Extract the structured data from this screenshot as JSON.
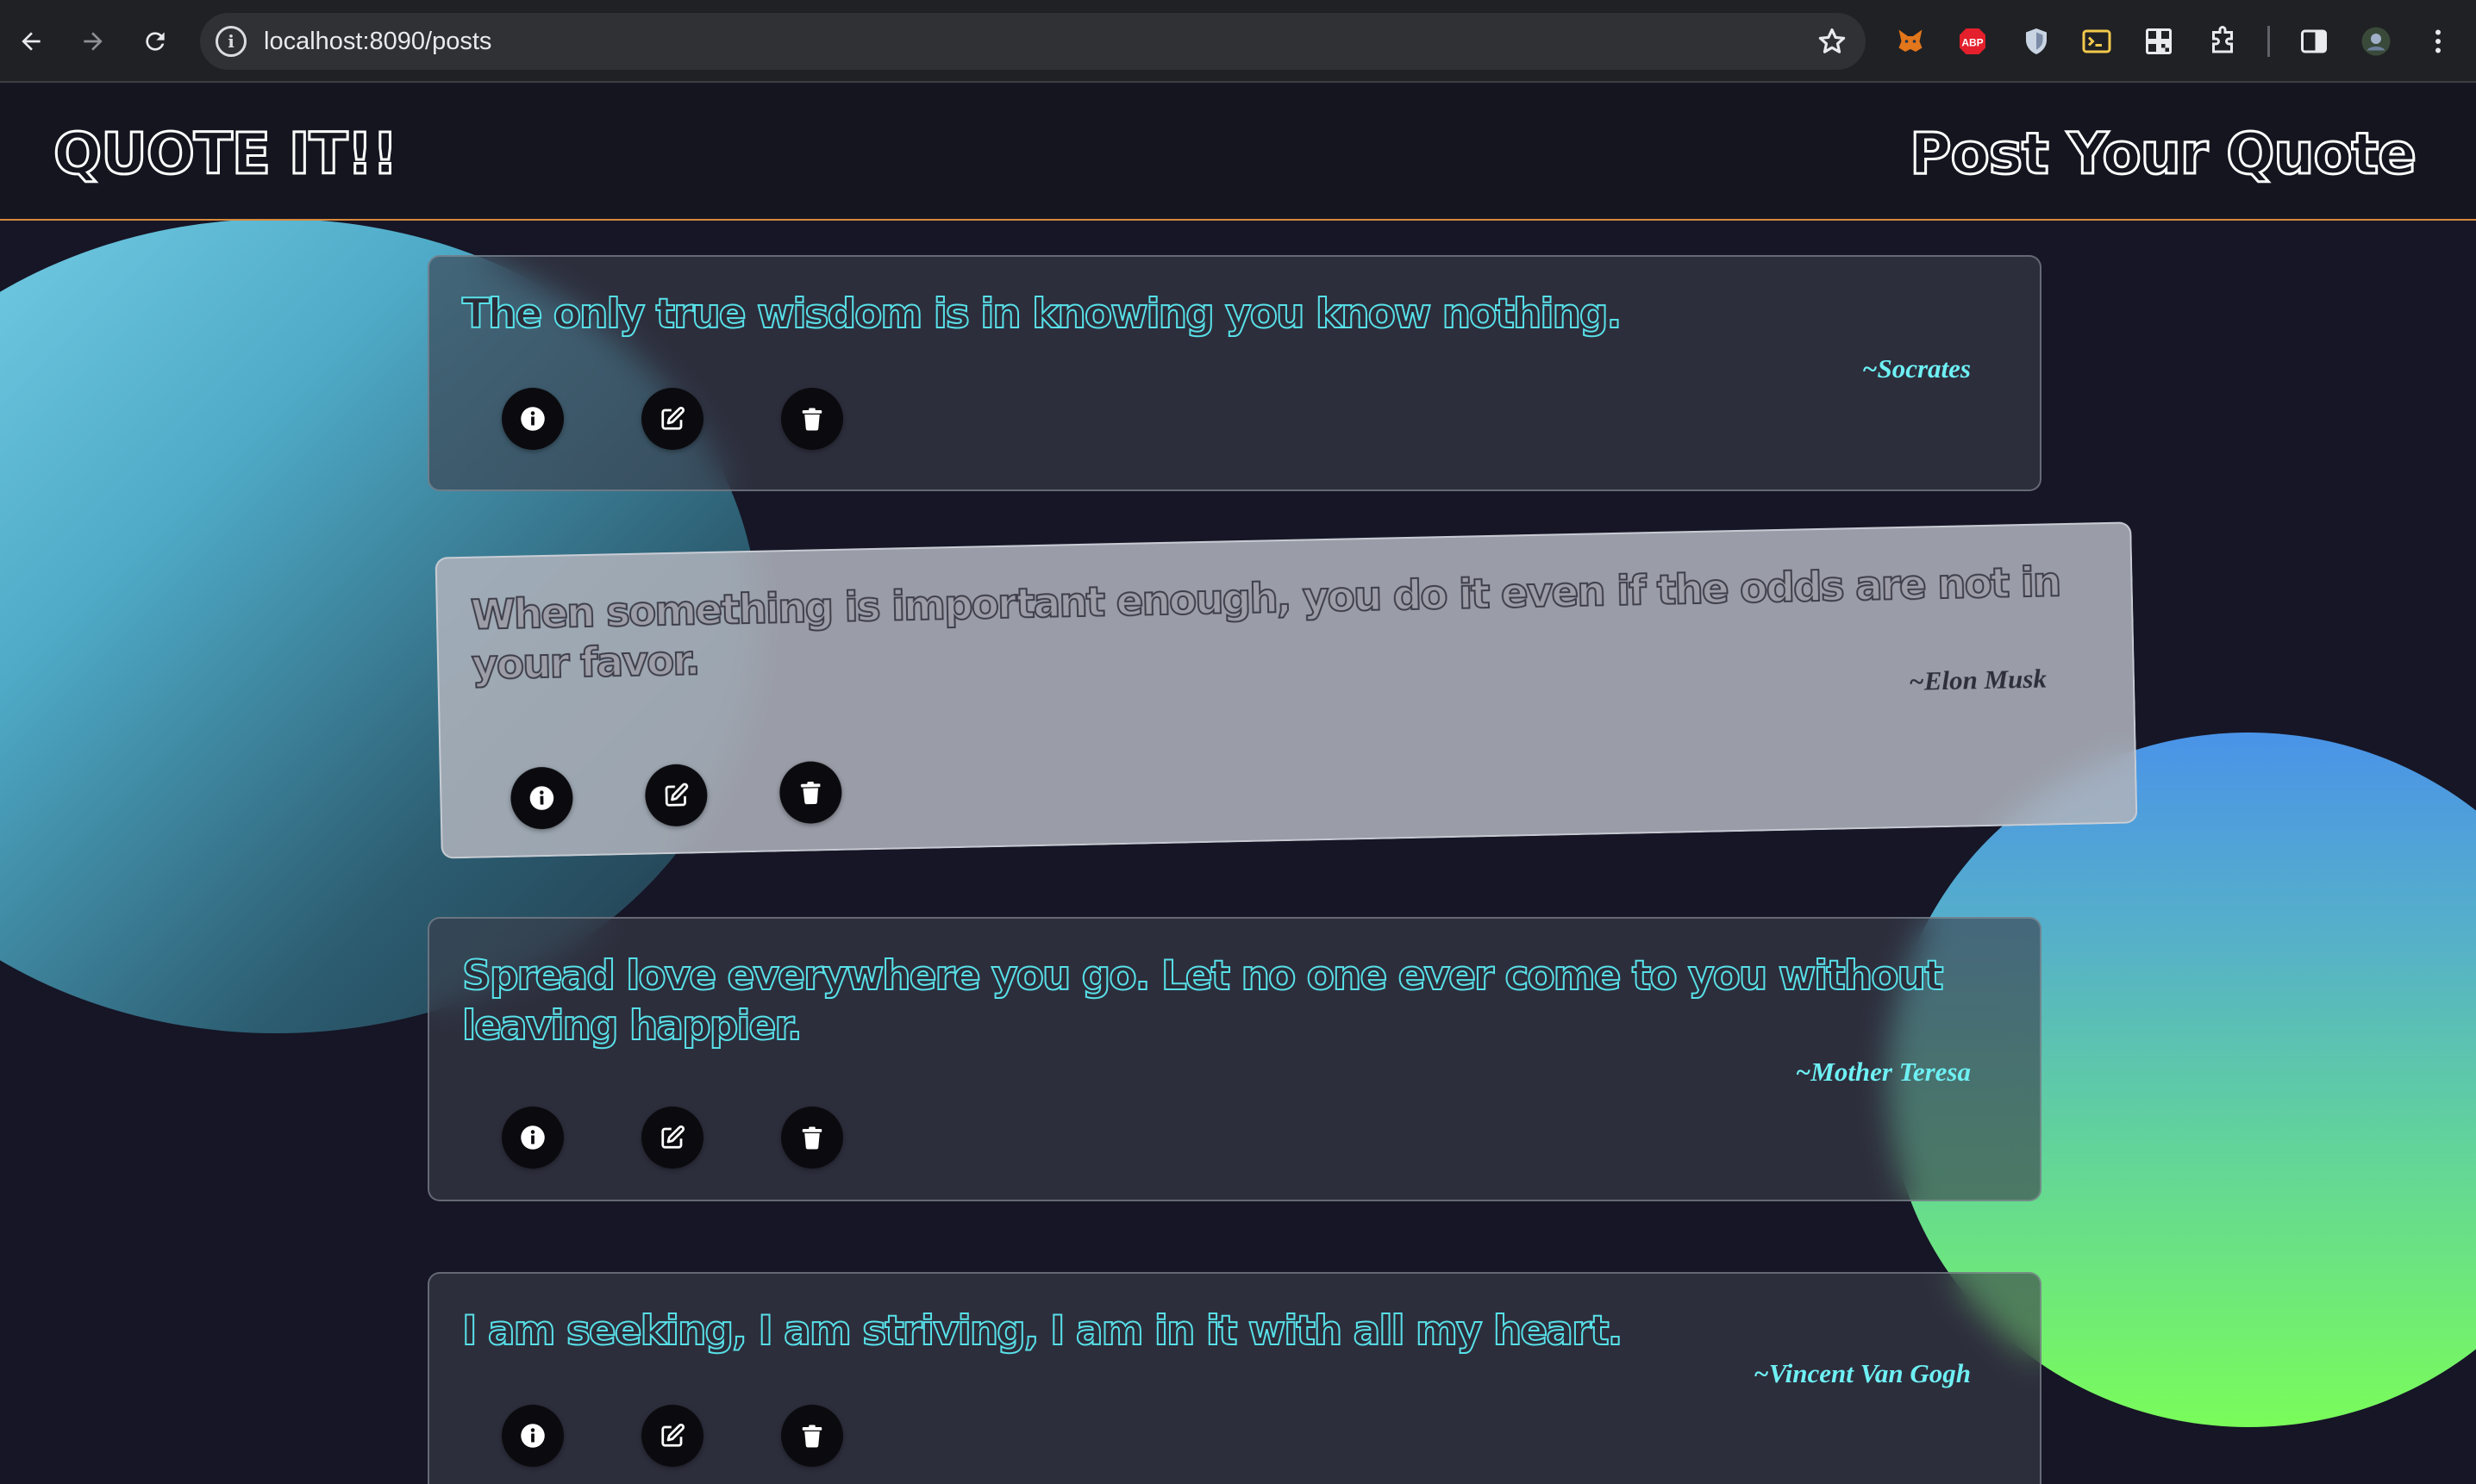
{
  "browser": {
    "url": "localhost:8090/posts",
    "extensions": [
      "metamask-fox-icon",
      "adblock-plus-icon",
      "shield-icon",
      "terminal-icon",
      "qr-code-icon",
      "puzzle-icon"
    ]
  },
  "header": {
    "logo": "QUOTE IT!!",
    "post_link": "Post Your Quote"
  },
  "posts": [
    {
      "quote": "The only true wisdom is in knowing you know nothing.",
      "author": "~Socrates"
    },
    {
      "quote": "When something is important enough, you do it even if the odds are not in your favor.",
      "author": "~Elon Musk"
    },
    {
      "quote": "Spread love everywhere you go. Let no one ever come to you without leaving happier.",
      "author": "~Mother Teresa"
    },
    {
      "quote": "I am seeking, I am striving, I am in it with all my heart.",
      "author": "~Vincent Van Gogh"
    }
  ],
  "colors": {
    "page_background": "#161626",
    "quote_outline": "#58e0e8",
    "author_text": "#6ef0f4",
    "header_border": "#d88a3c",
    "blob_blue": "#4eaac7",
    "blob_green": "#7afc5a"
  }
}
